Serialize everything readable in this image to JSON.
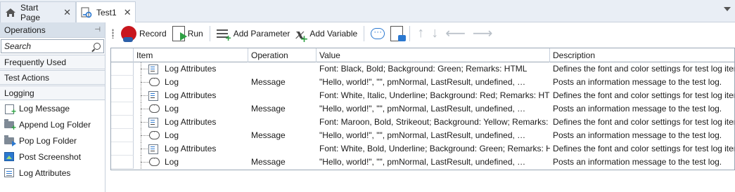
{
  "tabs": [
    {
      "label": "Start Page",
      "icon": "home-icon"
    },
    {
      "label": "Test1",
      "icon": "keyword-test-icon"
    }
  ],
  "panel": {
    "title": "Operations",
    "search_placeholder": "Search",
    "groups": [
      "Frequently Used",
      "Test Actions",
      "Logging"
    ],
    "operations": [
      {
        "label": "Log Message",
        "icon": "log-message-icon"
      },
      {
        "label": "Append Log Folder",
        "icon": "append-log-folder-icon"
      },
      {
        "label": "Pop Log Folder",
        "icon": "pop-log-folder-icon"
      },
      {
        "label": "Post Screenshot",
        "icon": "post-screenshot-icon"
      },
      {
        "label": "Log Attributes",
        "icon": "log-attributes-icon"
      }
    ]
  },
  "toolbar": {
    "record": "Record",
    "run": "Run",
    "add_parameter": "Add Parameter",
    "add_variable": "Add Variable"
  },
  "grid": {
    "columns": [
      "Item",
      "Operation",
      "Value",
      "Description"
    ],
    "rows": [
      {
        "item": "Log Attributes",
        "icon": "log-attributes-icon",
        "operation": "",
        "value": "Font: Black, Bold; Background: Green; Remarks: HTML",
        "description": "Defines the font and color settings for test log items."
      },
      {
        "item": "Log",
        "icon": "log-icon",
        "operation": "Message",
        "value": "\"Hello, world!\", \"\", pmNormal, LastResult, undefined, …",
        "description": "Posts an information message to the test log."
      },
      {
        "item": "Log Attributes",
        "icon": "log-attributes-icon",
        "operation": "",
        "value": "Font: White, Italic, Underline; Background: Red; Remarks: HTML",
        "description": "Defines the font and color settings for test log items."
      },
      {
        "item": "Log",
        "icon": "log-icon",
        "operation": "Message",
        "value": "\"Hello, world!\", \"\", pmNormal, LastResult, undefined, …",
        "description": "Posts an information message to the test log."
      },
      {
        "item": "Log Attributes",
        "icon": "log-attributes-icon",
        "operation": "",
        "value": "Font: Maroon, Bold, Strikeout; Background: Yellow; Remarks: HTML",
        "description": "Defines the font and color settings for test log items."
      },
      {
        "item": "Log",
        "icon": "log-icon",
        "operation": "Message",
        "value": "\"Hello, world!\", \"\", pmNormal, LastResult, undefined, …",
        "description": "Posts an information message to the test log."
      },
      {
        "item": "Log Attributes",
        "icon": "log-attributes-icon",
        "operation": "",
        "value": "Font: White, Bold, Underline; Background: Green; Remarks: HTML",
        "description": "Defines the font and color settings for test log items."
      },
      {
        "item": "Log",
        "icon": "log-icon",
        "operation": "Message",
        "value": "\"Hello, world!\", \"\", pmNormal, LastResult, undefined, …",
        "description": "Posts an information message to the test log."
      }
    ]
  }
}
